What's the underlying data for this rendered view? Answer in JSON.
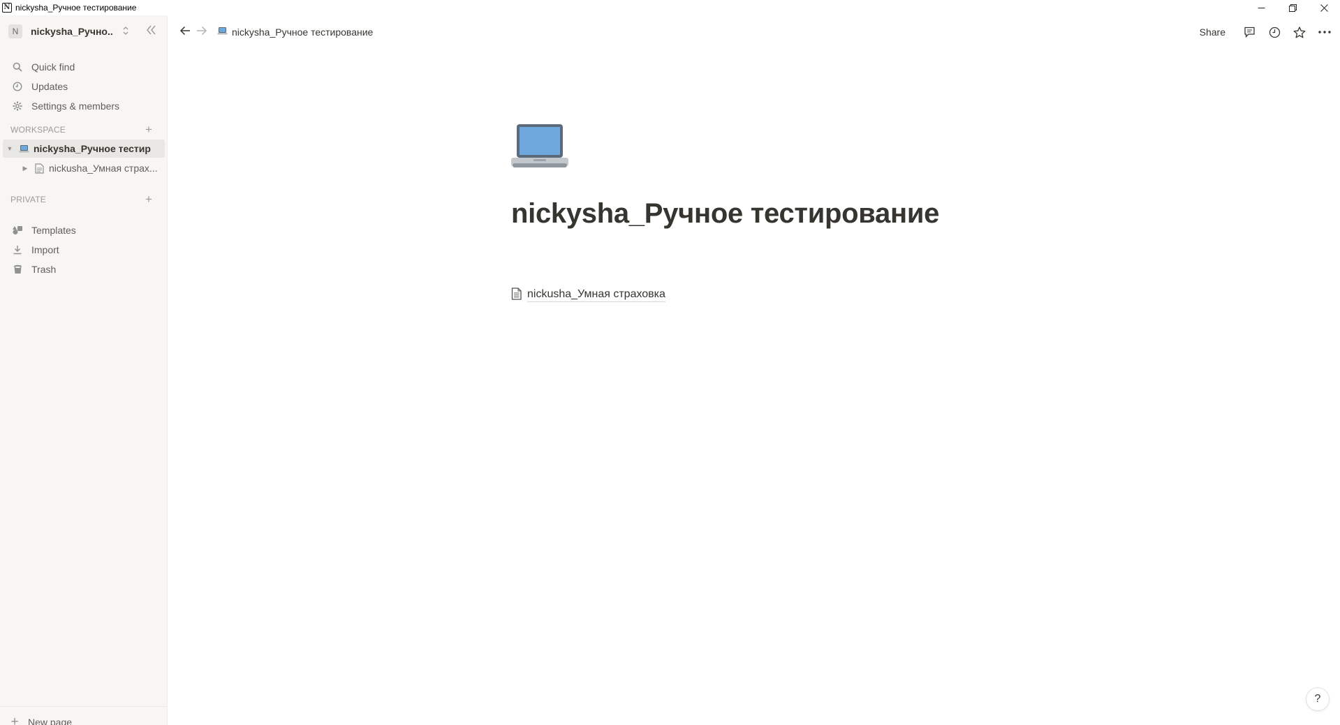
{
  "window": {
    "title": "nickysha_Ручное тестирование",
    "app_icon_letter": "N"
  },
  "sidebar": {
    "workspace": {
      "avatar_letter": "N",
      "name": "nickysha_Ручно..."
    },
    "nav": [
      {
        "label": "Quick find",
        "icon": "search-icon"
      },
      {
        "label": "Updates",
        "icon": "clock-icon"
      },
      {
        "label": "Settings & members",
        "icon": "gear-icon"
      }
    ],
    "workspace_section": {
      "label": "WORKSPACE",
      "pages": [
        {
          "label": "nickysha_Ручное тестир...",
          "icon": "laptop-icon",
          "expanded": true,
          "active": true
        },
        {
          "label": "nickusha_Умная страх...",
          "icon": "page-icon",
          "expanded": false,
          "active": false
        }
      ]
    },
    "private_section": {
      "label": "PRIVATE"
    },
    "tools": [
      {
        "label": "Templates",
        "icon": "templates-icon"
      },
      {
        "label": "Import",
        "icon": "import-icon"
      },
      {
        "label": "Trash",
        "icon": "trash-icon"
      }
    ],
    "new_page_label": "New page"
  },
  "topbar": {
    "breadcrumb": "nickysha_Ручное тестирование",
    "share_label": "Share"
  },
  "page": {
    "icon": "laptop-icon",
    "title": "nickysha_Ручное тестирование",
    "subpages": [
      {
        "label": "nickusha_Умная страховка",
        "icon": "page-icon"
      }
    ]
  },
  "help_label": "?"
}
